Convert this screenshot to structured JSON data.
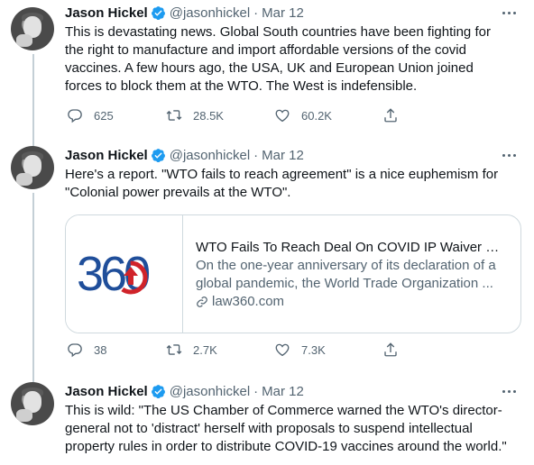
{
  "tweets": [
    {
      "name": "Jason Hickel",
      "handle": "@jasonhickel",
      "dot": "·",
      "date": "Mar 12",
      "text": "This is devastating news.  Global South countries have been fighting for\nthe right to manufacture and import affordable versions of the covid\nvaccines.  A few hours ago, the USA, UK and European Union joined\nforces to block them at the WTO.  The West is indefensible.",
      "replies": "625",
      "retweets": "28.5K",
      "likes": "60.2K"
    },
    {
      "name": "Jason Hickel",
      "handle": "@jasonhickel",
      "dot": "·",
      "date": "Mar 12",
      "text": "Here's a report.  \"WTO fails to reach agreement\" is a nice euphemism for\n\"Colonial power prevails at the WTO\".",
      "replies": "38",
      "retweets": "2.7K",
      "likes": "7.3K",
      "card": {
        "logo_text": "360",
        "title": "WTO Fails To Reach Deal On COVID IP Waiver Pr...",
        "description": "On the one-year anniversary of its declaration of a global pandemic, the World Trade Organization ...",
        "domain": "law360.com"
      }
    },
    {
      "name": "Jason Hickel",
      "handle": "@jasonhickel",
      "dot": "·",
      "date": "Mar 12",
      "text": "This is wild: \"The US Chamber of Commerce warned the WTO's director-\ngeneral not to 'distract' herself with proposals to suspend intellectual\nproperty rules in order to distribute COVID-19 vaccines around the world.\""
    }
  ],
  "icons": {
    "verified": "verified-badge-icon",
    "more": "more-icon",
    "reply": "reply-icon",
    "retweet": "retweet-icon",
    "like": "like-icon",
    "share": "share-icon",
    "link": "link-icon"
  },
  "colors": {
    "text": "#0f1419",
    "secondary": "#536471",
    "verified": "#1d9bf0",
    "logo_blue": "#1f4e9a",
    "logo_red": "#d0232a",
    "thread_line": "#c4cfd6"
  }
}
